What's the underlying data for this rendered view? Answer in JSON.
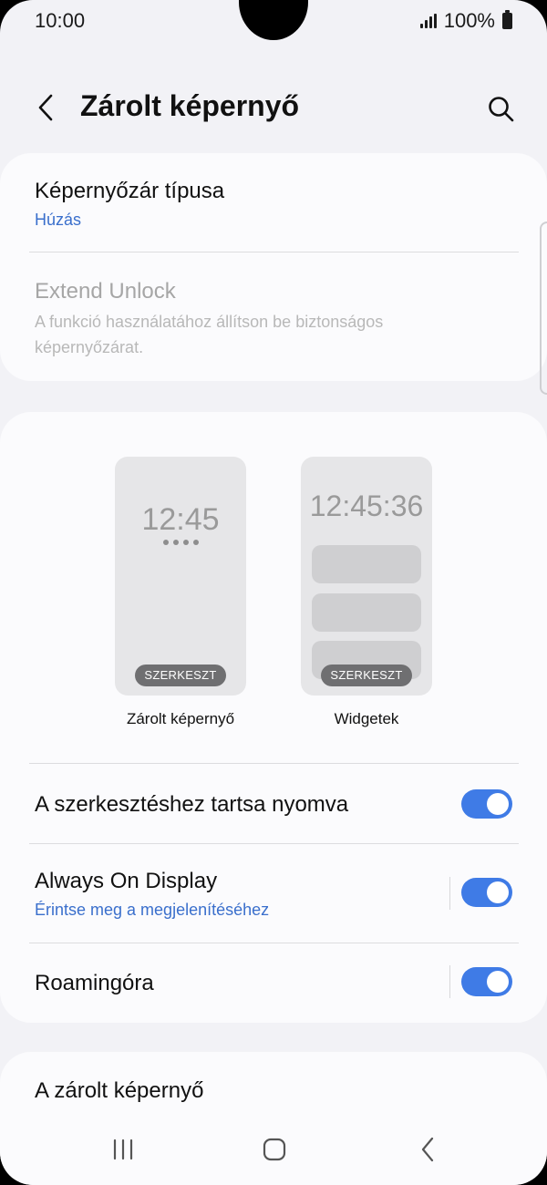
{
  "status": {
    "time": "10:00",
    "battery": "100%"
  },
  "header": {
    "title": "Zárolt képernyő"
  },
  "lock_type": {
    "title": "Képernyőzár típusa",
    "value": "Húzás"
  },
  "extend_unlock": {
    "title": "Extend Unlock",
    "description": "A funkció használatához állítson be biztonságos képernyőzárat."
  },
  "previews": {
    "lock_screen": {
      "clock": "12:45",
      "edit_label": "SZERKESZT",
      "caption": "Zárolt képernyő"
    },
    "widgets": {
      "clock": "12:45:36",
      "edit_label": "SZERKESZT",
      "caption": "Widgetek"
    }
  },
  "settings": [
    {
      "title": "A szerkesztéshez tartsa nyomva",
      "subtitle": "",
      "enabled": true
    },
    {
      "title": "Always On Display",
      "subtitle": "Érintse meg a megjelenítéséhez",
      "enabled": true
    },
    {
      "title": "Roamingóra",
      "subtitle": "",
      "enabled": true
    }
  ],
  "section": {
    "title": "A zárolt képernyő"
  },
  "colors": {
    "accent": "#3f7be6",
    "link": "#3a6fcc",
    "background": "#f2f2f6",
    "card": "#fbfbfd"
  },
  "icons": [
    "back-icon",
    "search-icon",
    "recents-icon",
    "home-icon",
    "nav-back-icon"
  ]
}
